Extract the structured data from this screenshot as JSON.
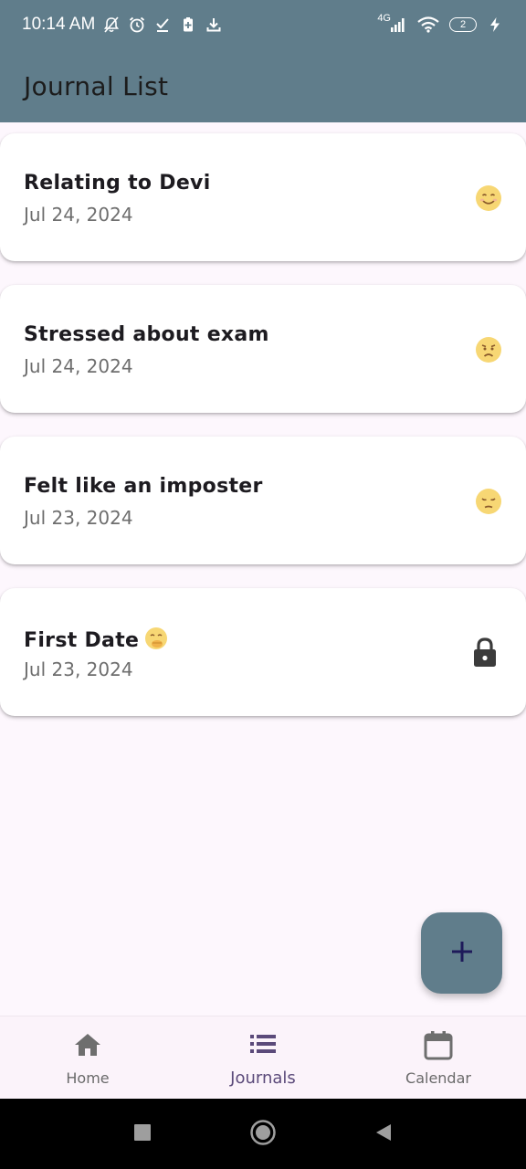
{
  "status_bar": {
    "time": "10:14 AM",
    "network": "4G",
    "battery_level": "2"
  },
  "app_bar": {
    "title": "Journal List"
  },
  "journals": [
    {
      "title": "Relating to Devi",
      "date": "Jul 24, 2024",
      "mood": "smiling-face-icon"
    },
    {
      "title": "Stressed about exam",
      "date": "Jul 24, 2024",
      "mood": "worried-face-icon"
    },
    {
      "title": "Felt like an imposter",
      "date": "Jul 23, 2024",
      "mood": "pensive-face-icon"
    },
    {
      "title": "First Date",
      "date": "Jul 23, 2024",
      "mood": "lock-icon",
      "locked": true
    }
  ],
  "fab": {
    "icon": "plus-icon"
  },
  "bottom_nav": {
    "items": [
      {
        "label": "Home",
        "icon": "home-icon",
        "active": false
      },
      {
        "label": "Journals",
        "icon": "list-icon",
        "active": true
      },
      {
        "label": "Calendar",
        "icon": "calendar-icon",
        "active": false
      }
    ]
  },
  "colors": {
    "primary": "#607d8b",
    "background": "#fdf7fd",
    "active_nav": "#5b4a7a",
    "emoji_yellow": "#f7d774"
  }
}
